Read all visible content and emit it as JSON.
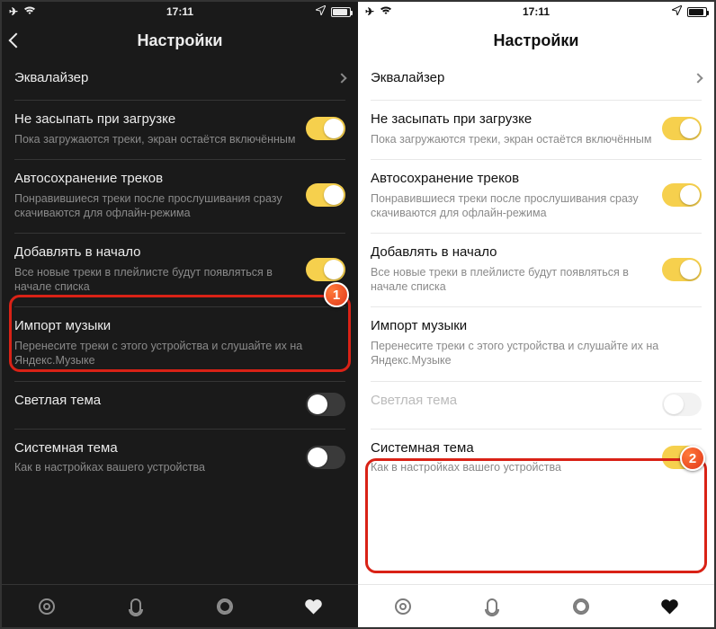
{
  "status": {
    "time": "17:11"
  },
  "header": {
    "title": "Настройки"
  },
  "rows": {
    "eq": {
      "title": "Эквалайзер"
    },
    "sleep": {
      "title": "Не засыпать при загрузке",
      "sub": "Пока загружаются треки, экран остаётся включённым"
    },
    "autosave": {
      "title": "Автосохранение треков",
      "sub": "Понравившиеся треки после прослушивания сразу скачиваются для офлайн-режима"
    },
    "addtop": {
      "title": "Добавлять в начало",
      "sub": "Все новые треки в плейлисте будут появляться в начале списка"
    },
    "import": {
      "title": "Импорт музыки",
      "sub": "Перенесите треки с этого устройства и слушайте их на Яндекс.Музыке"
    },
    "lightTheme": {
      "title": "Светлая тема"
    },
    "systemTheme": {
      "title": "Системная тема",
      "sub": "Как в настройках вашего устройства"
    }
  },
  "highlights": {
    "one": "1",
    "two": "2"
  },
  "screens": {
    "dark": {
      "lightThemeOn": false,
      "systemThemeOn": false
    },
    "light": {
      "lightThemeOn": false,
      "systemThemeOn": true,
      "lightThemeDisabled": true
    }
  }
}
